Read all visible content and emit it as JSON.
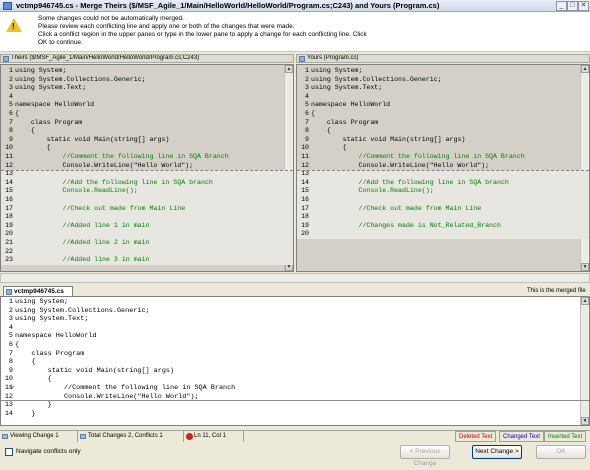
{
  "window": {
    "title": "vctmp946745.cs - Merge Theirs ($/MSF_Agile_1/Main/HelloWorld/HelloWorld/Program.cs;C243) and Yours (Program.cs)",
    "min": "_",
    "max": "□",
    "close": "✕"
  },
  "info": {
    "line1": "Some changes could not be automatically merged.",
    "line2": "Please review each conflicting line and apply one or both of the changes that were made.",
    "line3": "Click a conflict region in the upper panes or type in the lower pane to apply a change for each conflicting line. Click",
    "line4": "OK to continue."
  },
  "theirs": {
    "header": "Theirs ($/MSF_Agile_1/Main/HelloWorld/HelloWorld/Program.cs;C243)",
    "lines": [
      {
        "n": "1",
        "t": "using System;",
        "c": false
      },
      {
        "n": "2",
        "t": "using System.Collections.Generic;",
        "c": false
      },
      {
        "n": "3",
        "t": "using System.Text;",
        "c": false
      },
      {
        "n": "4",
        "t": "",
        "c": false
      },
      {
        "n": "5",
        "t": "namespace HelloWorld",
        "c": false
      },
      {
        "n": "6",
        "t": "{",
        "c": false
      },
      {
        "n": "7",
        "t": "    class Program",
        "c": false
      },
      {
        "n": "8",
        "t": "    {",
        "c": false
      },
      {
        "n": "9",
        "t": "        static void Main(string[] args)",
        "c": false
      },
      {
        "n": "10",
        "t": "        {",
        "c": false
      },
      {
        "n": "11",
        "t": "            //Comment the following line in SQA Branch",
        "c": true
      },
      {
        "n": "12",
        "t": "            Console.WriteLine(\"Hello World\");",
        "c": false
      },
      {
        "n": "13",
        "t": "",
        "c": false
      },
      {
        "n": "14",
        "t": "            //Add the following line in SQA branch",
        "c": true
      },
      {
        "n": "15",
        "t": "            Console.ReadLine();",
        "c": true
      },
      {
        "n": "16",
        "t": "",
        "c": false
      },
      {
        "n": "17",
        "t": "            //Check out made from Main Line",
        "c": true
      },
      {
        "n": "18",
        "t": "",
        "c": false
      },
      {
        "n": "19",
        "t": "            //Added line 1 in main",
        "c": true
      },
      {
        "n": "20",
        "t": "",
        "c": false
      },
      {
        "n": "21",
        "t": "            //Added line 2 in main",
        "c": true
      },
      {
        "n": "22",
        "t": "",
        "c": false
      },
      {
        "n": "23",
        "t": "            //Added line 3 in main",
        "c": true
      }
    ]
  },
  "yours": {
    "header": "Yours (Program.cs)",
    "lines": [
      {
        "n": "1",
        "t": "using System;",
        "c": false
      },
      {
        "n": "2",
        "t": "using System.Collections.Generic;",
        "c": false
      },
      {
        "n": "3",
        "t": "using System.Text;",
        "c": false
      },
      {
        "n": "4",
        "t": "",
        "c": false
      },
      {
        "n": "5",
        "t": "namespace HelloWorld",
        "c": false
      },
      {
        "n": "6",
        "t": "{",
        "c": false
      },
      {
        "n": "7",
        "t": "    class Program",
        "c": false
      },
      {
        "n": "8",
        "t": "    {",
        "c": false
      },
      {
        "n": "9",
        "t": "        static void Main(string[] args)",
        "c": false
      },
      {
        "n": "10",
        "t": "        {",
        "c": false
      },
      {
        "n": "11",
        "t": "            //Comment the following line in SQA Branch",
        "c": true
      },
      {
        "n": "12",
        "t": "            Console.WriteLine(\"Hello World\");",
        "c": false
      },
      {
        "n": "13",
        "t": "",
        "c": false
      },
      {
        "n": "14",
        "t": "            //Add the following line in SQA branch",
        "c": true
      },
      {
        "n": "15",
        "t": "            Console.ReadLine();",
        "c": true
      },
      {
        "n": "16",
        "t": "",
        "c": false
      },
      {
        "n": "17",
        "t": "            //Check out made from Main Line",
        "c": true
      },
      {
        "n": "18",
        "t": "",
        "c": false
      },
      {
        "n": "19",
        "t": "            //Changes made is Not_Related_Branch",
        "c": true
      },
      {
        "n": "20",
        "t": "",
        "c": false
      }
    ]
  },
  "merged": {
    "tab": "vctmp946745.cs",
    "note": "This is the merged file",
    "lines": [
      {
        "n": "1",
        "t": "using System;",
        "c": false
      },
      {
        "n": "2",
        "t": "using System.Collections.Generic;",
        "c": false
      },
      {
        "n": "3",
        "t": "using System.Text;",
        "c": false
      },
      {
        "n": "4",
        "t": "",
        "c": false
      },
      {
        "n": "5",
        "t": "namespace HelloWorld",
        "c": false
      },
      {
        "n": "6",
        "t": "{",
        "c": false
      },
      {
        "n": "7",
        "t": "    class Program",
        "c": false
      },
      {
        "n": "8",
        "t": "    {",
        "c": false
      },
      {
        "n": "9",
        "t": "        static void Main(string[] args)",
        "c": false
      },
      {
        "n": "10",
        "t": "        {",
        "c": false
      },
      {
        "n": "11",
        "t": "            //Comment the following line in SQA Branch",
        "c": false
      },
      {
        "n": "12",
        "t": "            Console.WriteLine(\"Hello World\");",
        "c": false
      },
      {
        "n": "13",
        "t": "        }",
        "c": false
      },
      {
        "n": "14",
        "t": "    }",
        "c": false
      }
    ]
  },
  "status": {
    "viewing": "Viewing Change 1",
    "total": "Total Changes 2, Conflicts 1",
    "position": "Ln 11, Col 1",
    "deleted": "Deleted Text",
    "changed": "Changed Text",
    "inserted": "Inserted Text",
    "deleted_color": "#cc0000",
    "changed_color": "#0000cc",
    "inserted_color": "#008000"
  },
  "footer": {
    "navigate_label": "Navigate conflicts only",
    "prev": "< Previous Change",
    "next": "Next Change >",
    "ok": "OK"
  }
}
